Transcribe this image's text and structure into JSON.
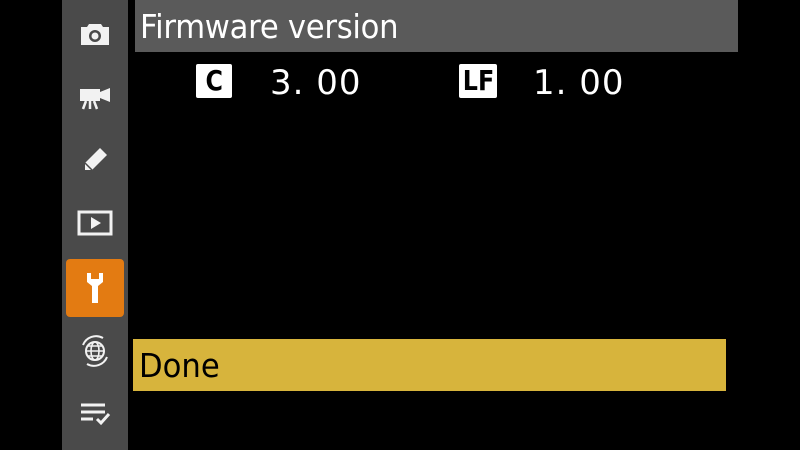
{
  "header": {
    "title": "Firmware version"
  },
  "firmware": [
    {
      "badge": "C",
      "version": "3. 00"
    },
    {
      "badge": "LF",
      "version": "1. 00"
    }
  ],
  "actions": {
    "done_label": "Done"
  },
  "sidebar": {
    "items": [
      {
        "icon": "camera-icon"
      },
      {
        "icon": "movie-camera-icon"
      },
      {
        "icon": "pencil-icon"
      },
      {
        "icon": "playback-icon"
      },
      {
        "icon": "wrench-icon",
        "active": true
      },
      {
        "icon": "network-globe-icon"
      },
      {
        "icon": "my-menu-icon"
      }
    ]
  },
  "colors": {
    "sidebar": "#4a4a4a",
    "active_tab": "#e37b12",
    "title_bar": "#5a5a5a",
    "selection": "#d7b43c",
    "background": "#000000"
  }
}
